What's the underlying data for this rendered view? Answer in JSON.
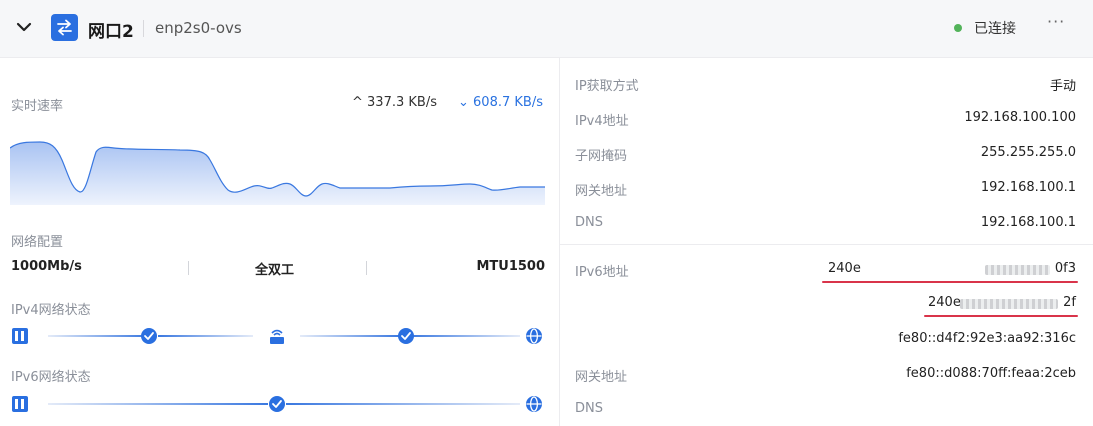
{
  "header": {
    "title": "网口2",
    "subtitle": "enp2s0-ovs",
    "status": "已连接",
    "more": "···",
    "status_color": "#52b35a",
    "accent": "#2a6fe0"
  },
  "realtime": {
    "label": "实时速率",
    "upload": "^ 337.3 KB/s",
    "download": "⌄ 608.7 KB/s"
  },
  "net_config": {
    "label": "网络配置",
    "speed": "1000Mb/s",
    "duplex": "全双工",
    "mtu": "MTU1500"
  },
  "ipv4_status": {
    "label": "IPv4网络状态"
  },
  "ipv6_status": {
    "label": "IPv6网络状态"
  },
  "ipv4_info": {
    "ip_method_label": "IP获取方式",
    "ip_method_value": "手动",
    "ipv4_label": "IPv4地址",
    "ipv4_value": "192.168.100.100",
    "mask_label": "子网掩码",
    "mask_value": "255.255.255.0",
    "gateway_label": "网关地址",
    "gateway_value": "192.168.100.1",
    "dns_label": "DNS",
    "dns_value": "192.168.100.1"
  },
  "ipv6_info": {
    "ipv6_label": "IPv6地址",
    "addr1_start": "240e",
    "addr1_end": "0f3",
    "addr2_start": "240e",
    "addr2_end": "2f",
    "addr3": "fe80::d4f2:92e3:aa92:316c",
    "gateway_label": "网关地址",
    "gateway_value": "fe80::d088:70ff:feaa:2ceb",
    "dns_label": "DNS"
  }
}
